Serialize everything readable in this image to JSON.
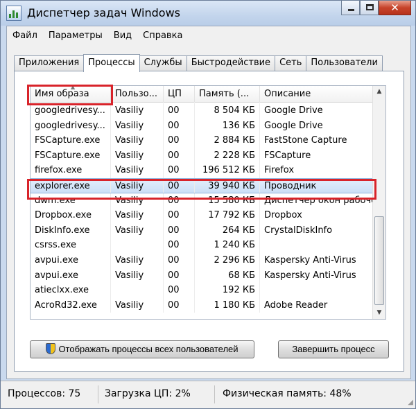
{
  "window": {
    "title": "Диспетчер задач Windows",
    "close_glyph": "✕"
  },
  "menu": [
    "Файл",
    "Параметры",
    "Вид",
    "Справка"
  ],
  "tabs": [
    "Приложения",
    "Процессы",
    "Службы",
    "Быстродействие",
    "Сеть",
    "Пользователи"
  ],
  "active_tab": "Процессы",
  "columns": [
    "Имя образа",
    "Пользо...",
    "ЦП",
    "Память (...",
    "Описание"
  ],
  "processes": [
    [
      "googledrivesy...",
      "Vasiliy",
      "00",
      "8 504 КБ",
      "Google Drive"
    ],
    [
      "googledrivesy...",
      "Vasiliy",
      "00",
      "136 КБ",
      "Google Drive"
    ],
    [
      "FSCapture.exe",
      "Vasiliy",
      "00",
      "2 884 КБ",
      "FastStone Capture"
    ],
    [
      "FSCapture.exe",
      "Vasiliy",
      "00",
      "2 228 КБ",
      "FSCapture"
    ],
    [
      "firefox.exe",
      "Vasiliy",
      "00",
      "196 512 КБ",
      "Firefox"
    ],
    [
      "explorer.exe",
      "Vasiliy",
      "00",
      "39 940 КБ",
      "Проводник"
    ],
    [
      "dwm.exe",
      "Vasiliy",
      "00",
      "15 580 КБ",
      "Диспетчер окон рабочего стола"
    ],
    [
      "Dropbox.exe",
      "Vasiliy",
      "00",
      "17 792 КБ",
      "Dropbox"
    ],
    [
      "DiskInfo.exe",
      "Vasiliy",
      "00",
      "264 КБ",
      "CrystalDiskInfo"
    ],
    [
      "csrss.exe",
      "",
      "00",
      "1 240 КБ",
      ""
    ],
    [
      "avpui.exe",
      "Vasiliy",
      "00",
      "2 296 КБ",
      "Kaspersky Anti-Virus"
    ],
    [
      "avpui.exe",
      "Vasiliy",
      "00",
      "68 КБ",
      "Kaspersky Anti-Virus"
    ],
    [
      "atieclxx.exe",
      "",
      "00",
      "192 КБ",
      ""
    ],
    [
      "AcroRd32.exe",
      "Vasiliy",
      "00",
      "1 180 КБ",
      "Adobe Reader"
    ]
  ],
  "selected_process": "explorer.exe",
  "buttons": {
    "show_all": "Отображать процессы всех пользователей",
    "end_process": "Завершить процесс"
  },
  "status": {
    "processes": "Процессов: 75",
    "cpu": "Загрузка ЦП: 2%",
    "memory": "Физическая память: 48%"
  },
  "icons": [
    "task-manager-icon",
    "minimize-icon",
    "maximize-icon",
    "close-icon",
    "uac-shield-icon",
    "scroll-up-icon",
    "scroll-down-icon",
    "size-grip-icon"
  ],
  "colors": {
    "highlight_box": "#d8232a",
    "title_bar": "#c3d5ec",
    "close_button": "#c7442b",
    "selection": "#cbdff6"
  }
}
